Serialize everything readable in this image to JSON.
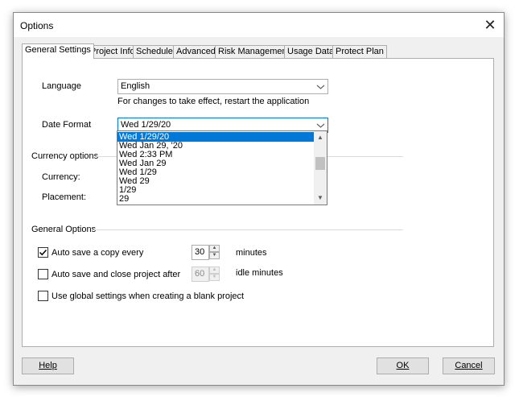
{
  "window": {
    "title": "Options"
  },
  "tabs": [
    "General Settings",
    "Project Info",
    "Schedule",
    "Advanced",
    "Risk Management",
    "Usage Data",
    "Protect Plan"
  ],
  "language": {
    "label": "Language",
    "value": "English",
    "note": "For changes to take effect, restart the application"
  },
  "date_format": {
    "label": "Date Format",
    "value": "Wed 1/29/20",
    "options": [
      "Wed 1/29/20",
      "Wed Jan 29, '20",
      "Wed 2:33 PM",
      "Wed Jan 29",
      "Wed 1/29",
      "Wed 29",
      "1/29",
      "29"
    ]
  },
  "currency": {
    "section": "Currency options",
    "currency_label": "Currency:",
    "placement_label": "Placement:"
  },
  "general_options": {
    "section": "General Options",
    "autosave": {
      "label": "Auto save a copy every",
      "checked": true,
      "value": "30",
      "unit": "minutes"
    },
    "autoclose": {
      "label": "Auto save and close project after",
      "checked": false,
      "value": "60",
      "unit": "idle minutes"
    },
    "global": {
      "label": "Use global settings when creating a blank project",
      "checked": false
    }
  },
  "buttons": {
    "help": "Help",
    "ok": "OK",
    "cancel": "Cancel"
  },
  "colors": {
    "selection": "#0078d7",
    "focus_border": "#0078d7"
  }
}
